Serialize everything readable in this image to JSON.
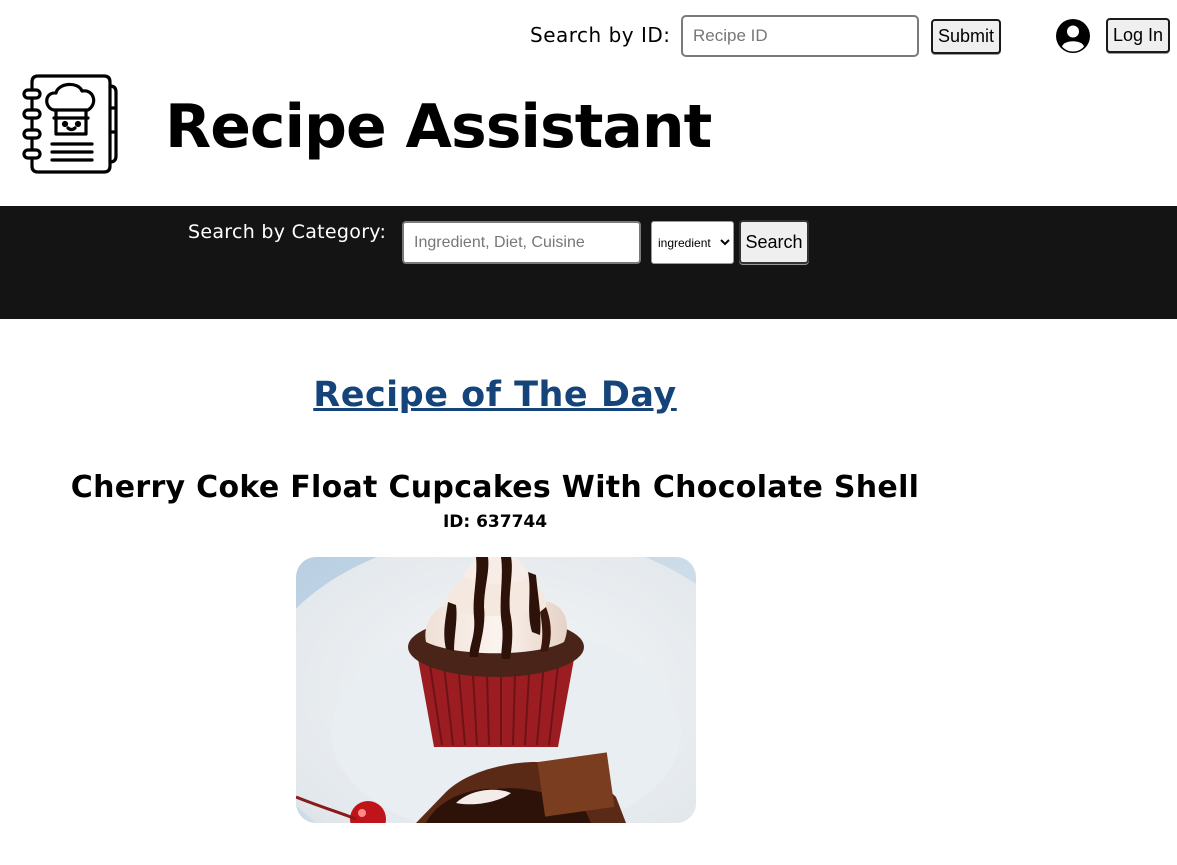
{
  "header": {
    "search_by_id_label": "Search by ID:",
    "id_placeholder": "Recipe ID",
    "submit_label": "Submit",
    "login_label": "Log In",
    "user_icon": "user-circle-icon"
  },
  "brand": {
    "title": "Recipe Assistant",
    "logo_icon": "chef-cookbook-icon"
  },
  "category_bar": {
    "label": "Search by Category:",
    "placeholder": "Ingredient, Diet, Cuisine",
    "select_value": "ingredient",
    "search_label": "Search",
    "background": "#141414"
  },
  "main": {
    "section_title": "Recipe of The Day",
    "section_title_color": "#14447a",
    "recipe_name": "Cherry Coke Float Cupcakes With Chocolate Shell",
    "recipe_id": "ID: 637744",
    "image_subject": "cupcake-photo"
  }
}
